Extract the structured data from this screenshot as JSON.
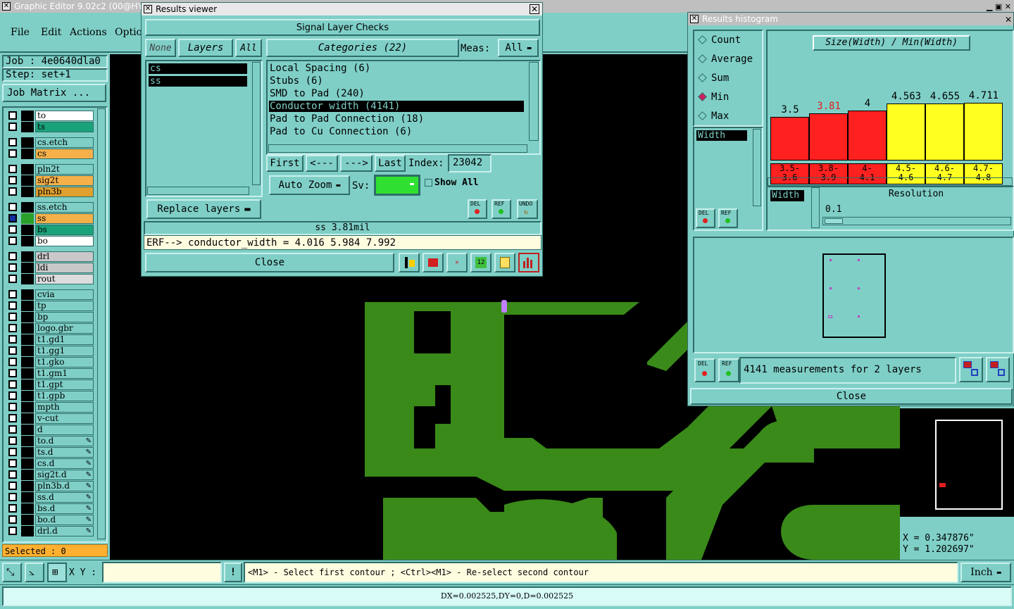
{
  "app": {
    "title": "Graphic Editor 9.02c2 (00@HY-H"
  },
  "menu": {
    "file": "File",
    "edit": "Edit",
    "actions": "Actions",
    "options": "Optio"
  },
  "left": {
    "job": "Job : 4e0640dla0",
    "step": "Step: set+1",
    "job_matrix": "Job Matrix ...",
    "selected": "Selected : 0",
    "layers": [
      {
        "name": "to",
        "color": "#ffffff"
      },
      {
        "name": "ts",
        "color": "#1aa37a"
      },
      {
        "name": "cs.etch",
        "color": "#7fcfc7"
      },
      {
        "name": "cs",
        "color": "#f5b04a"
      },
      {
        "name": "pln2t",
        "color": "#7fcfc7"
      },
      {
        "name": "sig2t",
        "color": "#f5b04a"
      },
      {
        "name": "pln3b",
        "color": "#e0a030"
      },
      {
        "name": "ss.etch",
        "color": "#7fcfc7"
      },
      {
        "name": "ss",
        "color": "#f5b04a"
      },
      {
        "name": "bs",
        "color": "#1aa37a"
      },
      {
        "name": "bo",
        "color": "#ffffff"
      },
      {
        "name": "drl",
        "color": "#c8c8c8"
      },
      {
        "name": "ldi",
        "color": "#c8c8c8"
      },
      {
        "name": "rout",
        "color": "#dcdcdc"
      },
      {
        "name": "cvia",
        "color": "#7fcfc7"
      },
      {
        "name": "tp",
        "color": "#7fcfc7"
      },
      {
        "name": "bp",
        "color": "#7fcfc7"
      },
      {
        "name": "logo.gbr",
        "color": "#7fcfc7"
      },
      {
        "name": "t1.gd1",
        "color": "#7fcfc7"
      },
      {
        "name": "t1.gg1",
        "color": "#7fcfc7"
      },
      {
        "name": "t1.gko",
        "color": "#7fcfc7"
      },
      {
        "name": "t1.gm1",
        "color": "#7fcfc7"
      },
      {
        "name": "t1.gpt",
        "color": "#7fcfc7"
      },
      {
        "name": "t1.gpb",
        "color": "#7fcfc7"
      },
      {
        "name": "mpth",
        "color": "#7fcfc7"
      },
      {
        "name": "v-cut",
        "color": "#7fcfc7"
      },
      {
        "name": "d",
        "color": "#7fcfc7"
      },
      {
        "name": "to.d",
        "color": "#7fcfc7"
      },
      {
        "name": "ts.d",
        "color": "#7fcfc7"
      },
      {
        "name": "cs.d",
        "color": "#7fcfc7"
      },
      {
        "name": "sig2t.d",
        "color": "#7fcfc7"
      },
      {
        "name": "pln3b.d",
        "color": "#7fcfc7"
      },
      {
        "name": "ss.d",
        "color": "#7fcfc7"
      },
      {
        "name": "bs.d",
        "color": "#7fcfc7"
      },
      {
        "name": "bo.d",
        "color": "#7fcfc7"
      },
      {
        "name": "drl.d",
        "color": "#7fcfc7"
      }
    ]
  },
  "viewer": {
    "title": "Results viewer",
    "header": "Signal Layer Checks",
    "none": "None",
    "layers": "Layers",
    "all": "All",
    "layer_items": [
      "cs",
      "ss"
    ],
    "categories_label": "Categories (22)",
    "meas_label": "Meas:",
    "meas_value": "All",
    "categories": [
      "Local Spacing (6)",
      "Stubs (6)",
      "SMD to Pad (240)",
      "Conductor width (4141)",
      "Pad to Pad Connection (18)",
      "Pad to Cu Connection (6)"
    ],
    "first": "First",
    "prev": "<---",
    "next": "--->",
    "last": "Last",
    "index_label": "Index:",
    "index_value": "23042",
    "auto_zoom": "Auto Zoom",
    "sv_label": "Sv:",
    "show_all": "Show All",
    "replace_layers": "Replace layers",
    "del": "DEL",
    "ref": "REF",
    "undo": "UNDO",
    "status": "ss 3.81mil",
    "erf": "ERF--> conductor_width = 4.016 5.984 7.992",
    "close": "Close"
  },
  "histogram": {
    "title": "Results histogram",
    "modes": [
      "Count",
      "Average",
      "Sum",
      "Min",
      "Max"
    ],
    "selected_mode": "Min",
    "chart_title": "Size(Width) / Min(Width)",
    "list_item": "Width",
    "bars": [
      {
        "value": "3.5",
        "range": "3.5-\n3.6",
        "color": "#ff2020",
        "level": 0.55
      },
      {
        "value": "3.81",
        "range": "3.8-\n3.9",
        "color": "#ff2020",
        "level": 0.6
      },
      {
        "value": "4",
        "range": "4-\n4.1",
        "color": "#ff2020",
        "level": 0.63
      },
      {
        "value": "4.563",
        "range": "4.5-\n4.6",
        "color": "#ffff20",
        "level": 0.72
      },
      {
        "value": "4.655",
        "range": "4.6-\n4.7",
        "color": "#ffff20",
        "level": 0.72
      },
      {
        "value": "4.711",
        "range": "4.7-\n4.8",
        "color": "#ffff20",
        "level": 0.73
      }
    ],
    "width_label": "Width",
    "resolution_label": "Resolution",
    "resolution_value": "0.1",
    "del": "DEL",
    "ref": "REF",
    "measurements": "4141 measurements for 2 layers",
    "close": "Close"
  },
  "coords": {
    "x": "X = 0.347876\"",
    "y": "Y = 1.202697\""
  },
  "bottom": {
    "xy_label": "X Y :",
    "excl": "!",
    "hint": "<M1> - Select first contour ; <Ctrl><M1> - Re-select second contour",
    "unit": "Inch",
    "status": "DX=0.002525,DY=0,D=0.002525"
  },
  "colors": {
    "panel": "#7fcfc7",
    "copper": "#3a8a1a",
    "canvas": "#000000",
    "accent": "#ffb030"
  }
}
